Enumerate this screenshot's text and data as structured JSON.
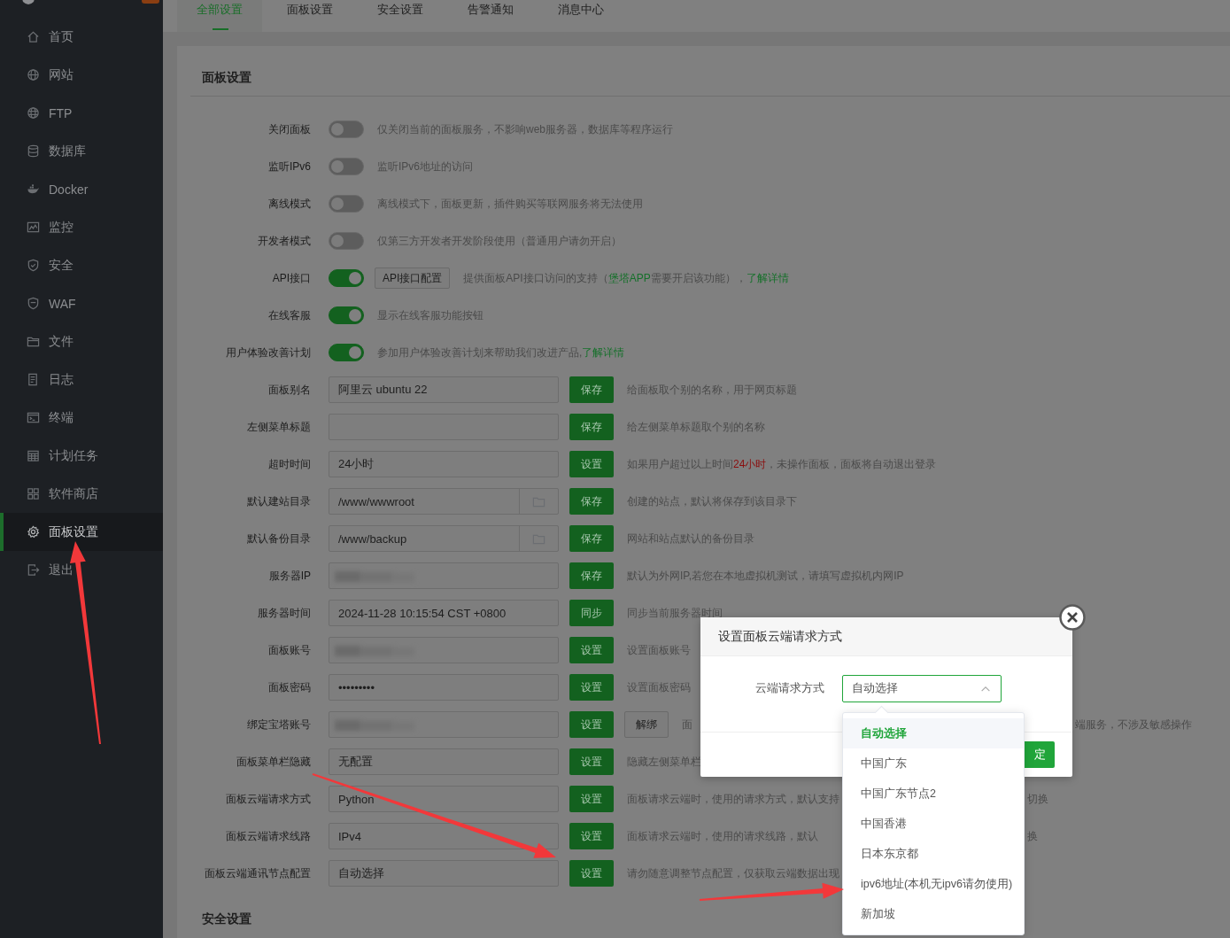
{
  "sidebar": {
    "items": [
      {
        "label": "首页",
        "selected": false
      },
      {
        "label": "网站",
        "selected": false
      },
      {
        "label": "FTP",
        "selected": false
      },
      {
        "label": "数据库",
        "selected": false
      },
      {
        "label": "Docker",
        "selected": false
      },
      {
        "label": "监控",
        "selected": false
      },
      {
        "label": "安全",
        "selected": false
      },
      {
        "label": "WAF",
        "selected": false
      },
      {
        "label": "文件",
        "selected": false
      },
      {
        "label": "日志",
        "selected": false
      },
      {
        "label": "终端",
        "selected": false
      },
      {
        "label": "计划任务",
        "selected": false
      },
      {
        "label": "软件商店",
        "selected": false
      },
      {
        "label": "面板设置",
        "selected": true
      },
      {
        "label": "退出",
        "selected": false
      }
    ]
  },
  "tabs": [
    {
      "label": "全部设置",
      "selected": true
    },
    {
      "label": "面板设置",
      "selected": false
    },
    {
      "label": "安全设置",
      "selected": false
    },
    {
      "label": "告警通知",
      "selected": false
    },
    {
      "label": "消息中心",
      "selected": false
    }
  ],
  "section_title": "面板设置",
  "rows": [
    {
      "kind": "toggle",
      "label": "关闭面板",
      "on": false,
      "desc": [
        {
          "kind": "plain",
          "text": "仅关闭当前的面板服务，不影响web服务器，数据库等程序运行"
        }
      ]
    },
    {
      "kind": "toggle",
      "label": "监听IPv6",
      "on": false,
      "desc": [
        {
          "kind": "plain",
          "text": "监听IPv6地址的访问"
        }
      ]
    },
    {
      "kind": "toggle",
      "label": "离线模式",
      "on": false,
      "desc": [
        {
          "kind": "plain",
          "text": "离线模式下，面板更新，插件购买等联网服务将无法使用"
        }
      ]
    },
    {
      "kind": "toggle",
      "label": "开发者模式",
      "on": false,
      "desc": [
        {
          "kind": "plain",
          "text": "仅第三方开发者开发阶段使用（普通用户请勿开启）"
        }
      ]
    },
    {
      "kind": "toggle",
      "label": "API接口",
      "on": true,
      "extra_button": "API接口配置",
      "desc": [
        {
          "kind": "plain",
          "text": "提供面板API接口访问的支持（"
        },
        {
          "kind": "accent",
          "text": "堡塔APP"
        },
        {
          "kind": "plain",
          "text": "需要开启该功能），"
        },
        {
          "kind": "link",
          "text": "了解详情"
        }
      ]
    },
    {
      "kind": "toggle",
      "label": "在线客服",
      "on": true,
      "desc": [
        {
          "kind": "plain",
          "text": "显示在线客服功能按钮"
        }
      ]
    },
    {
      "kind": "toggle",
      "label": "用户体验改善计划",
      "on": true,
      "desc": [
        {
          "kind": "plain",
          "text": "参加用户体验改善计划来帮助我们改进产品,"
        },
        {
          "kind": "link",
          "text": "了解详情"
        }
      ]
    },
    {
      "kind": "input",
      "label": "面板别名",
      "value": "阿里云 ubuntu 22",
      "button": "保存",
      "desc": [
        {
          "kind": "plain",
          "text": "给面板取个别的名称，用于网页标题"
        }
      ]
    },
    {
      "kind": "input",
      "label": "左侧菜单标题",
      "button": "保存",
      "desc": [
        {
          "kind": "plain",
          "text": "给左侧菜单标题取个别的名称"
        }
      ]
    },
    {
      "kind": "input",
      "label": "超时时间",
      "value": "24小时",
      "button": "设置",
      "desc": [
        {
          "kind": "plain",
          "text": "如果用户超过以上时间"
        },
        {
          "kind": "warn",
          "text": "24小时"
        },
        {
          "kind": "plain",
          "text": "，未操作面板，面板将自动退出登录"
        }
      ]
    },
    {
      "kind": "input",
      "label": "默认建站目录",
      "value": "/www/wwwroot",
      "folder_picker": true,
      "button": "保存",
      "desc": [
        {
          "kind": "plain",
          "text": "创建的站点，默认将保存到该目录下"
        }
      ]
    },
    {
      "kind": "input",
      "label": "默认备份目录",
      "value": "/www/backup",
      "folder_picker": true,
      "button": "保存",
      "desc": [
        {
          "kind": "plain",
          "text": "网站和站点默认的备份目录"
        }
      ]
    },
    {
      "kind": "input",
      "label": "服务器IP",
      "redacted": true,
      "button": "保存",
      "desc": [
        {
          "kind": "plain",
          "text": "默认为外网IP,若您在本地虚拟机测试，请填写虚拟机内网IP"
        }
      ]
    },
    {
      "kind": "input",
      "label": "服务器时间",
      "value": "2024-11-28 10:15:54 CST +0800",
      "button": "同步",
      "desc": [
        {
          "kind": "plain",
          "text": "同步当前服务器时间"
        }
      ]
    },
    {
      "kind": "input",
      "label": "面板账号",
      "redacted": true,
      "button": "设置",
      "desc": [
        {
          "kind": "plain",
          "text": "设置面板账号"
        }
      ]
    },
    {
      "kind": "input",
      "label": "面板密码",
      "value": "•••••••••",
      "button": "设置",
      "desc": [
        {
          "kind": "plain",
          "text": "设置面板密码"
        }
      ]
    },
    {
      "kind": "input",
      "label": "绑定宝塔账号",
      "redacted": true,
      "button": "设置",
      "extra_button": "解绑",
      "desc": [
        {
          "kind": "plain",
          "text": "面"
        }
      ],
      "tail": "端服务，不涉及敏感操作"
    },
    {
      "kind": "input",
      "label": "面板菜单栏隐藏",
      "value": "无配置",
      "button": "设置",
      "desc": [
        {
          "kind": "plain",
          "text": "隐藏左侧菜单栏"
        }
      ]
    },
    {
      "kind": "input",
      "label": "面板云端请求方式",
      "value": "Python",
      "button": "设置",
      "desc": [
        {
          "kind": "plain",
          "text": "面板请求云端时，使用的请求方式，默认支持"
        }
      ],
      "tail": "切换"
    },
    {
      "kind": "input",
      "label": "面板云端请求线路",
      "value": "IPv4",
      "button": "设置",
      "desc": [
        {
          "kind": "plain",
          "text": "面板请求云端时，使用的请求线路，默认"
        }
      ],
      "tail": "换"
    },
    {
      "kind": "input",
      "label": "面板云端通讯节点配置",
      "value": "自动选择",
      "button": "设置",
      "desc": [
        {
          "kind": "plain",
          "text": "请勿随意调整节点配置，仅获取云端数据出现"
        }
      ]
    }
  ],
  "next_section_title": "安全设置",
  "modal": {
    "title": "设置面板云端请求方式",
    "field_label": "云端请求方式",
    "value": "自动选择",
    "expanded": true,
    "confirm_button": "定",
    "options": [
      {
        "label": "自动选择",
        "selected": true
      },
      {
        "label": "中国广东",
        "selected": false
      },
      {
        "label": "中国广东节点2",
        "selected": false
      },
      {
        "label": "中国香港",
        "selected": false
      },
      {
        "label": "日本东京都",
        "selected": false
      },
      {
        "label": "ipv6地址(本机无ipv6请勿使用)",
        "selected": false
      },
      {
        "label": "新加坡",
        "selected": false
      }
    ]
  },
  "annotations": [
    {
      "kind": "arrow"
    },
    {
      "kind": "arrow"
    },
    {
      "kind": "arrow"
    }
  ]
}
